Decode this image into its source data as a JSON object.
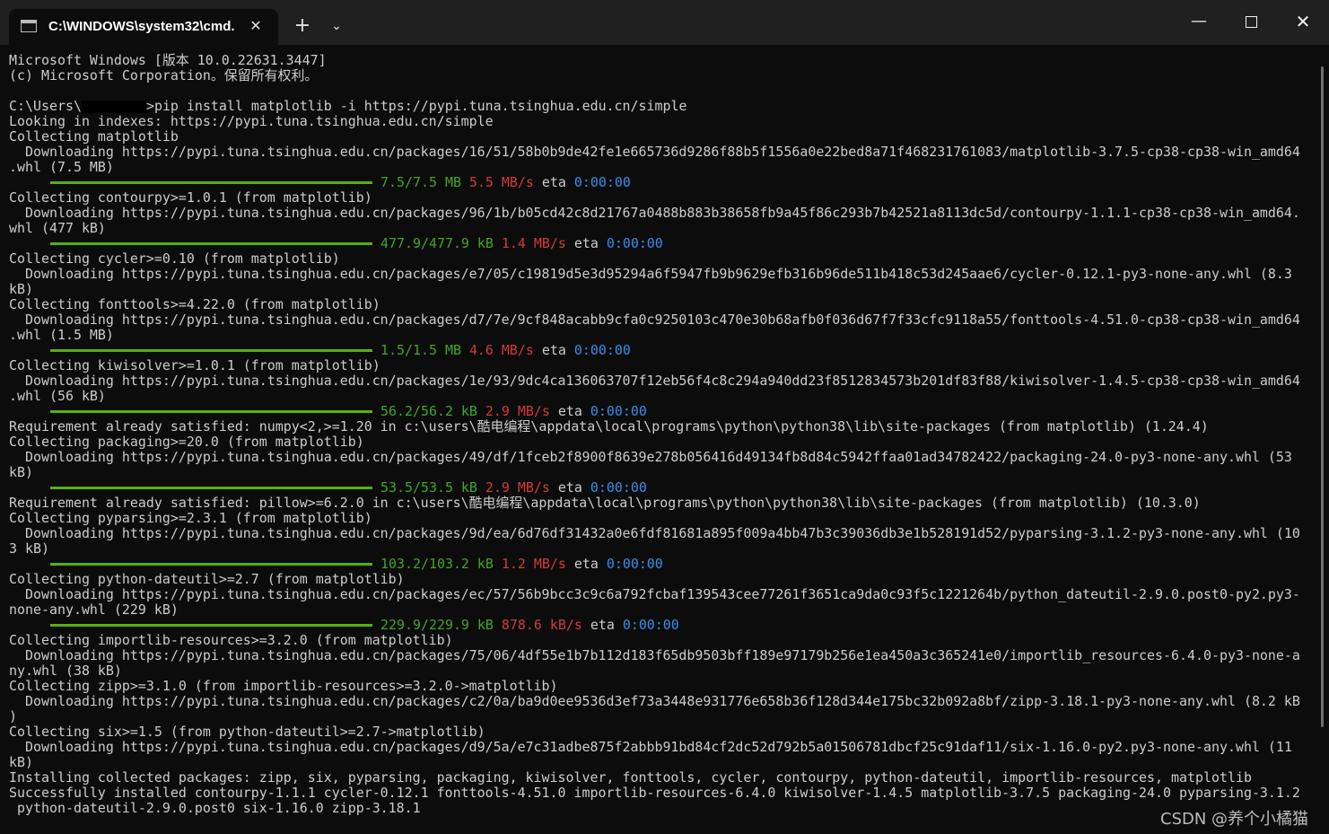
{
  "window": {
    "tab_title": "C:\\WINDOWS\\system32\\cmd.",
    "new_tab_glyph": "+",
    "dropdown_glyph": "⌄",
    "close_tab_glyph": "✕",
    "minimize_glyph": "—",
    "close_glyph": "✕"
  },
  "console": {
    "header1": "Microsoft Windows [版本 10.0.22631.3447]",
    "header2": "(c) Microsoft Corporation。保留所有权利。",
    "prompt_prefix": "C:\\Users\\",
    "prompt_cmd": ">pip install matplotlib -i https://pypi.tuna.tsinghua.edu.cn/simple",
    "l_index": "Looking in indexes: https://pypi.tuna.tsinghua.edu.cn/simple",
    "l_c1": "Collecting matplotlib",
    "l_d1a": "  Downloading https://pypi.tuna.tsinghua.edu.cn/packages/16/51/58b0b9de42fe1e665736d9286f88b5f1556a0e22bed8a71f468231761083/matplotlib-3.7.5-cp38-cp38-win_amd64",
    "l_d1b": ".whl (7.5 MB)",
    "p1": {
      "size": "7.5/7.5 MB",
      "speed": "5.5 MB/s",
      "eta_label": "eta",
      "eta": "0:00:00"
    },
    "l_c2": "Collecting contourpy>=1.0.1 (from matplotlib)",
    "l_d2a": "  Downloading https://pypi.tuna.tsinghua.edu.cn/packages/96/1b/b05cd42c8d21767a0488b883b38658fb9a45f86c293b7b42521a8113dc5d/contourpy-1.1.1-cp38-cp38-win_amd64.",
    "l_d2b": "whl (477 kB)",
    "p2": {
      "size": "477.9/477.9 kB",
      "speed": "1.4 MB/s",
      "eta_label": "eta",
      "eta": "0:00:00"
    },
    "l_c3": "Collecting cycler>=0.10 (from matplotlib)",
    "l_d3a": "  Downloading https://pypi.tuna.tsinghua.edu.cn/packages/e7/05/c19819d5e3d95294a6f5947fb9b9629efb316b96de511b418c53d245aae6/cycler-0.12.1-py3-none-any.whl (8.3",
    "l_d3b": "kB)",
    "l_c4": "Collecting fonttools>=4.22.0 (from matplotlib)",
    "l_d4a": "  Downloading https://pypi.tuna.tsinghua.edu.cn/packages/d7/7e/9cf848acabb9cfa0c9250103c470e30b68afb0f036d67f7f33cfc9118a55/fonttools-4.51.0-cp38-cp38-win_amd64",
    "l_d4b": ".whl (1.5 MB)",
    "p4": {
      "size": "1.5/1.5 MB",
      "speed": "4.6 MB/s",
      "eta_label": "eta",
      "eta": "0:00:00"
    },
    "l_c5": "Collecting kiwisolver>=1.0.1 (from matplotlib)",
    "l_d5a": "  Downloading https://pypi.tuna.tsinghua.edu.cn/packages/1e/93/9dc4ca136063707f12eb56f4c8c294a940dd23f8512834573b201df83f88/kiwisolver-1.4.5-cp38-cp38-win_amd64",
    "l_d5b": ".whl (56 kB)",
    "p5": {
      "size": "56.2/56.2 kB",
      "speed": "2.9 MB/s",
      "eta_label": "eta",
      "eta": "0:00:00"
    },
    "l_r1": "Requirement already satisfied: numpy<2,>=1.20 in c:\\users\\酷电编程\\appdata\\local\\programs\\python\\python38\\lib\\site-packages (from matplotlib) (1.24.4)",
    "l_c6": "Collecting packaging>=20.0 (from matplotlib)",
    "l_d6a": "  Downloading https://pypi.tuna.tsinghua.edu.cn/packages/49/df/1fceb2f8900f8639e278b056416d49134fb8d84c5942ffaa01ad34782422/packaging-24.0-py3-none-any.whl (53",
    "l_d6b": "kB)",
    "p6": {
      "size": "53.5/53.5 kB",
      "speed": "2.9 MB/s",
      "eta_label": "eta",
      "eta": "0:00:00"
    },
    "l_r2": "Requirement already satisfied: pillow>=6.2.0 in c:\\users\\酷电编程\\appdata\\local\\programs\\python\\python38\\lib\\site-packages (from matplotlib) (10.3.0)",
    "l_c7": "Collecting pyparsing>=2.3.1 (from matplotlib)",
    "l_d7a": "  Downloading https://pypi.tuna.tsinghua.edu.cn/packages/9d/ea/6d76df31432a0e6fdf81681a895f009a4bb47b3c39036db3e1b528191d52/pyparsing-3.1.2-py3-none-any.whl (10",
    "l_d7b": "3 kB)",
    "p7": {
      "size": "103.2/103.2 kB",
      "speed": "1.2 MB/s",
      "eta_label": "eta",
      "eta": "0:00:00"
    },
    "l_c8": "Collecting python-dateutil>=2.7 (from matplotlib)",
    "l_d8a": "  Downloading https://pypi.tuna.tsinghua.edu.cn/packages/ec/57/56b9bcc3c9c6a792fcbaf139543cee77261f3651ca9da0c93f5c1221264b/python_dateutil-2.9.0.post0-py2.py3-",
    "l_d8b": "none-any.whl (229 kB)",
    "p8": {
      "size": "229.9/229.9 kB",
      "speed": "878.6 kB/s",
      "eta_label": "eta",
      "eta": "0:00:00"
    },
    "l_c9": "Collecting importlib-resources>=3.2.0 (from matplotlib)",
    "l_d9a": "  Downloading https://pypi.tuna.tsinghua.edu.cn/packages/75/06/4df55e1b7b112d183f65db9503bff189e97179b256e1ea450a3c365241e0/importlib_resources-6.4.0-py3-none-a",
    "l_d9b": "ny.whl (38 kB)",
    "l_c10": "Collecting zipp>=3.1.0 (from importlib-resources>=3.2.0->matplotlib)",
    "l_d10a": "  Downloading https://pypi.tuna.tsinghua.edu.cn/packages/c2/0a/ba9d0ee9536d3ef73a3448e931776e658b36f128d344e175bc32b092a8bf/zipp-3.18.1-py3-none-any.whl (8.2 kB",
    "l_d10b": ")",
    "l_c11": "Collecting six>=1.5 (from python-dateutil>=2.7->matplotlib)",
    "l_d11a": "  Downloading https://pypi.tuna.tsinghua.edu.cn/packages/d9/5a/e7c31adbe875f2abbb91bd84cf2dc52d792b5a01506781dbcf25c91daf11/six-1.16.0-py2.py3-none-any.whl (11",
    "l_d11b": "kB)",
    "l_inst": "Installing collected packages: zipp, six, pyparsing, packaging, kiwisolver, fonttools, cycler, contourpy, python-dateutil, importlib-resources, matplotlib",
    "l_succ_a": "Successfully installed contourpy-1.1.1 cycler-0.12.1 fonttools-4.51.0 importlib-resources-6.4.0 kiwisolver-1.4.5 matplotlib-3.7.5 packaging-24.0 pyparsing-3.1.2",
    "l_succ_b": " python-dateutil-2.9.0.post0 six-1.16.0 zipp-3.18.1"
  },
  "watermark": "CSDN @养个小橘猫",
  "colors": {
    "background": "#0c0c0c",
    "text": "#cccccc",
    "progress_green": "#56b00f",
    "size_green": "#3fa823",
    "speed_red": "#d23b3b",
    "eta_blue": "#3b8eea"
  }
}
